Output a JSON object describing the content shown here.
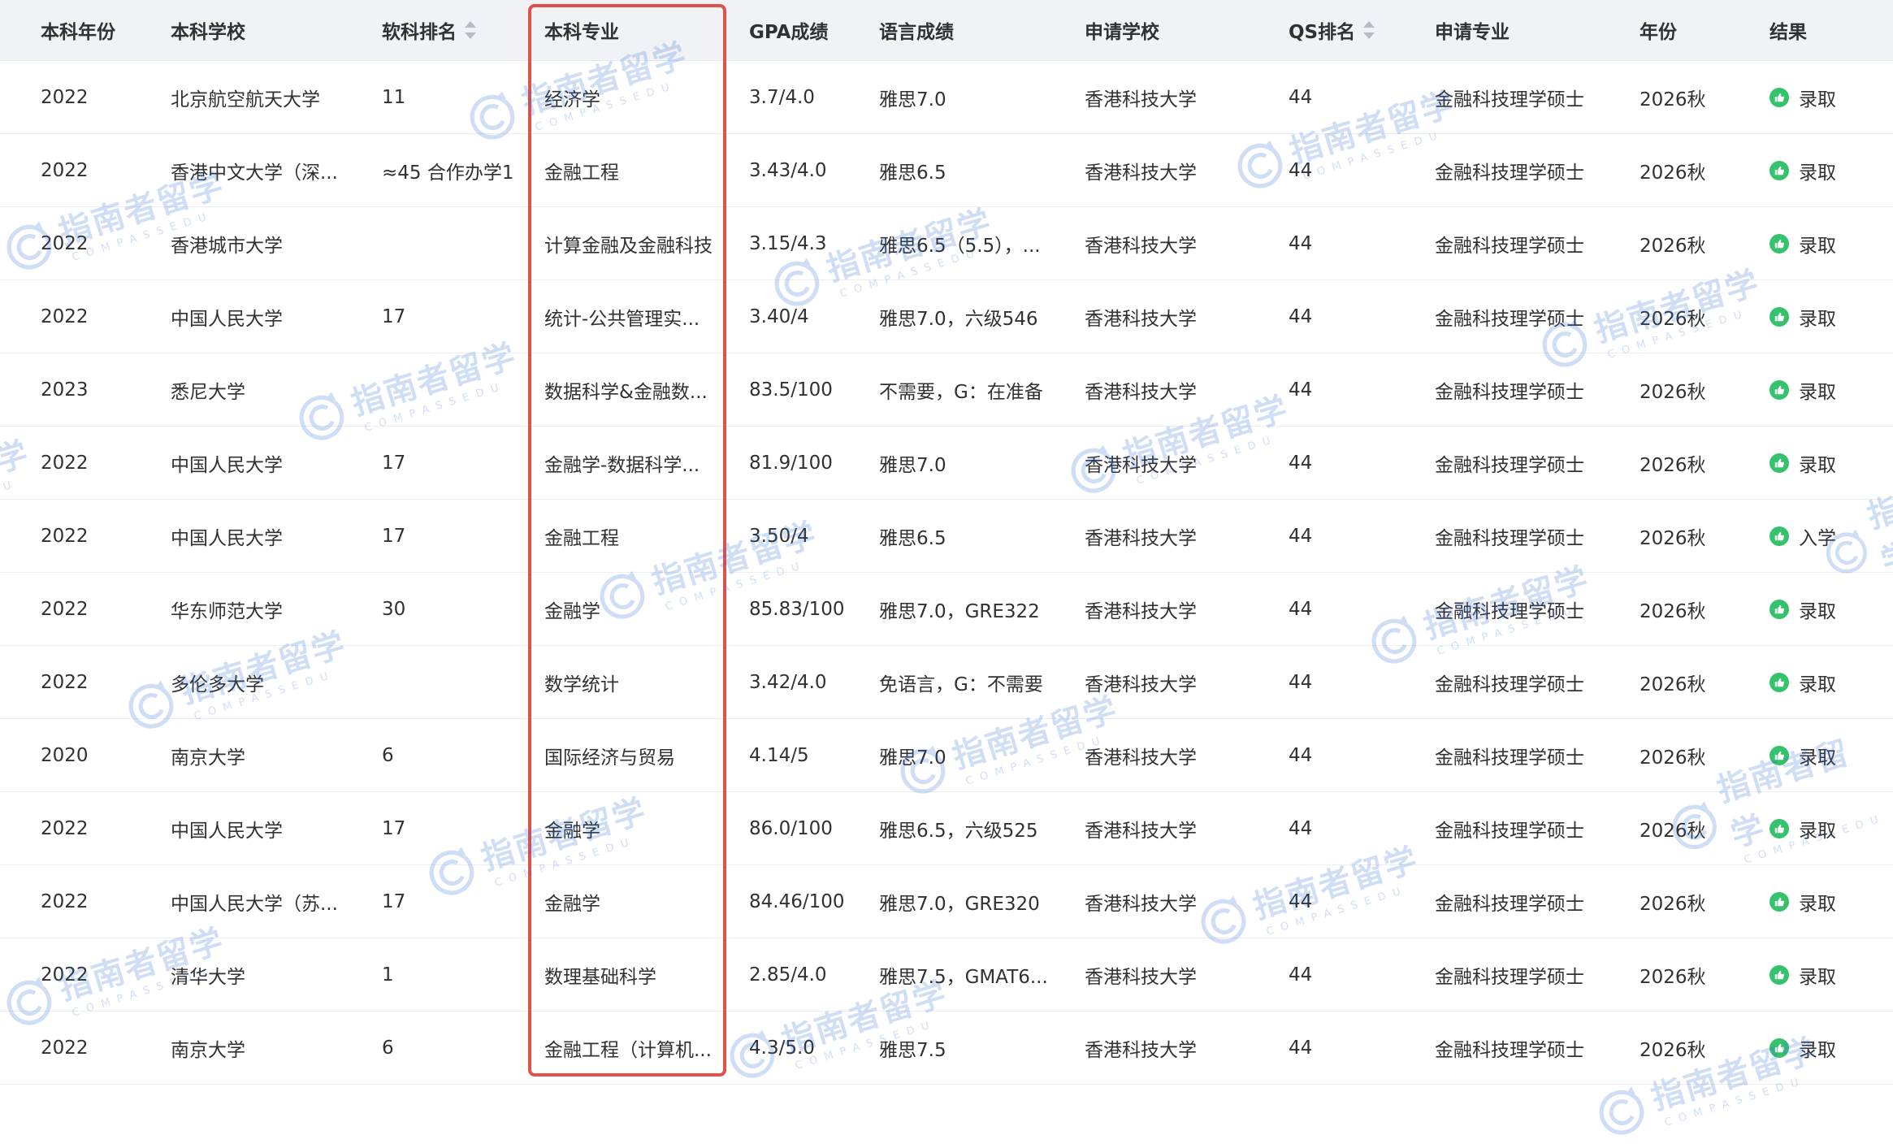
{
  "columns": [
    "本科年份",
    "本科学校",
    "软科排名",
    "本科专业",
    "GPA成绩",
    "语言成绩",
    "申请学校",
    "QS排名",
    "申请专业",
    "年份",
    "结果"
  ],
  "rows": [
    [
      "2022",
      "北京航空航天大学",
      "11",
      "经济学",
      "3.7/4.0",
      "雅思7.0",
      "香港科技大学",
      "44",
      "金融科技理学硕士",
      "2026秋",
      "录取"
    ],
    [
      "2022",
      "香港中文大学（深...",
      "≈45 合作办学1",
      "金融工程",
      "3.43/4.0",
      "雅思6.5",
      "香港科技大学",
      "44",
      "金融科技理学硕士",
      "2026秋",
      "录取"
    ],
    [
      "2022",
      "香港城市大学",
      "",
      "计算金融及金融科技",
      "3.15/4.3",
      "雅思6.5（5.5），...",
      "香港科技大学",
      "44",
      "金融科技理学硕士",
      "2026秋",
      "录取"
    ],
    [
      "2022",
      "中国人民大学",
      "17",
      "统计-公共管理实...",
      "3.40/4",
      "雅思7.0，六级546",
      "香港科技大学",
      "44",
      "金融科技理学硕士",
      "2026秋",
      "录取"
    ],
    [
      "2023",
      "悉尼大学",
      "",
      "数据科学&金融数...",
      "83.5/100",
      "不需要，G：在准备",
      "香港科技大学",
      "44",
      "金融科技理学硕士",
      "2026秋",
      "录取"
    ],
    [
      "2022",
      "中国人民大学",
      "17",
      "金融学-数据科学...",
      "81.9/100",
      "雅思7.0",
      "香港科技大学",
      "44",
      "金融科技理学硕士",
      "2026秋",
      "录取"
    ],
    [
      "2022",
      "中国人民大学",
      "17",
      "金融工程",
      "3.50/4",
      "雅思6.5",
      "香港科技大学",
      "44",
      "金融科技理学硕士",
      "2026秋",
      "入学"
    ],
    [
      "2022",
      "华东师范大学",
      "30",
      "金融学",
      "85.83/100",
      "雅思7.0，GRE322",
      "香港科技大学",
      "44",
      "金融科技理学硕士",
      "2026秋",
      "录取"
    ],
    [
      "2022",
      "多伦多大学",
      "",
      "数学统计",
      "3.42/4.0",
      "免语言，G：不需要",
      "香港科技大学",
      "44",
      "金融科技理学硕士",
      "2026秋",
      "录取"
    ],
    [
      "2020",
      "南京大学",
      "6",
      "国际经济与贸易",
      "4.14/5",
      "雅思7.0",
      "香港科技大学",
      "44",
      "金融科技理学硕士",
      "2026秋",
      "录取"
    ],
    [
      "2022",
      "中国人民大学",
      "17",
      "金融学",
      "86.0/100",
      "雅思6.5，六级525",
      "香港科技大学",
      "44",
      "金融科技理学硕士",
      "2026秋",
      "录取"
    ],
    [
      "2022",
      "中国人民大学（苏...",
      "17",
      "金融学",
      "84.46/100",
      "雅思7.0，GRE320",
      "香港科技大学",
      "44",
      "金融科技理学硕士",
      "2026秋",
      "录取"
    ],
    [
      "2022",
      "清华大学",
      "1",
      "数理基础科学",
      "2.85/4.0",
      "雅思7.5，GMAT6...",
      "香港科技大学",
      "44",
      "金融科技理学硕士",
      "2026秋",
      "录取"
    ],
    [
      "2022",
      "南京大学",
      "6",
      "金融工程（计算机...",
      "4.3/5.0",
      "雅思7.5",
      "香港科技大学",
      "44",
      "金融科技理学硕士",
      "2026秋",
      "录取"
    ]
  ],
  "watermark": {
    "text": "指南者留学",
    "sub": "COMPASSEDU"
  },
  "colors": {
    "accent_red": "#e2504c",
    "success_green": "#34c26d",
    "header_bg": "#f0f2f5"
  }
}
